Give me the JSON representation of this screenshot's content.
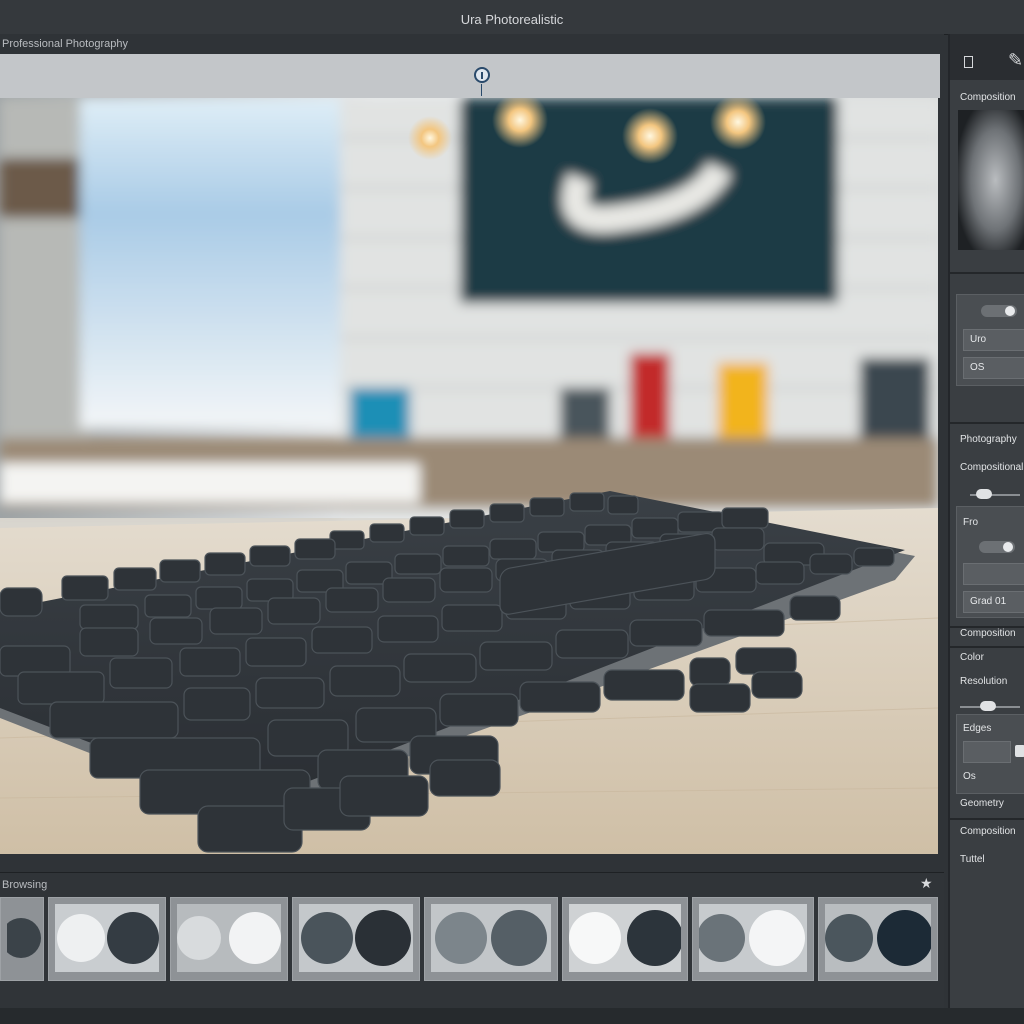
{
  "window": {
    "title": "Ura Photorealistic"
  },
  "canvas": {
    "panel_label": "Professional Photography"
  },
  "filmstrip": {
    "label": "Browsing"
  },
  "right_panel": {
    "preview_label": "Composition",
    "fields": [
      "Uro",
      "OS"
    ],
    "section1": "Photography",
    "section2": "Compositional",
    "group_label": "Fro",
    "group_value": "Grad 01",
    "section3": "Composition",
    "section4": "Color",
    "section5": "Resolution",
    "section6": "Edges",
    "section7": "Os",
    "section8": "Geometry",
    "section9": "Composition",
    "section10": "Tuttel"
  },
  "colors": {
    "accent": "#2a4a6b",
    "keyboard": "#2f3438",
    "panel": "#3a3e42"
  }
}
